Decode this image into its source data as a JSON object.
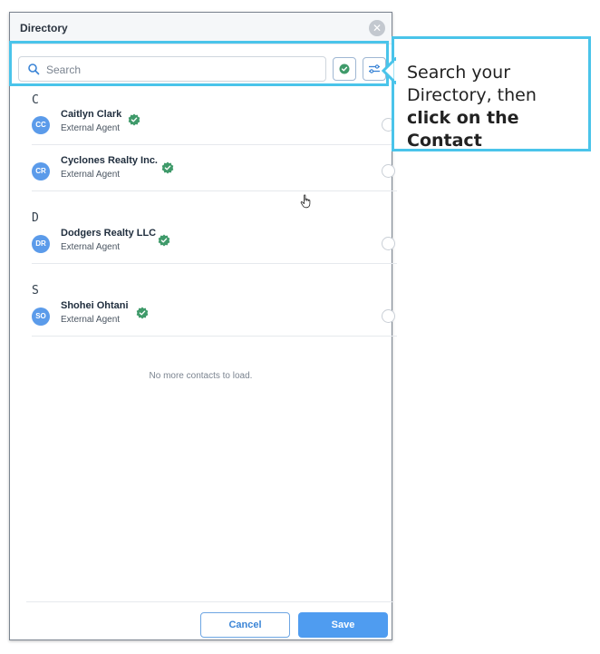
{
  "modal": {
    "title": "Directory",
    "close_icon": "close-icon"
  },
  "search": {
    "placeholder": "Search",
    "value": "",
    "icon": "search-icon",
    "verified_filter_icon": "verified-check-icon",
    "filter_icon": "sliders-icon"
  },
  "sections": [
    {
      "letter": "C",
      "contacts": [
        {
          "initials": "CC",
          "name": "Caitlyn Clark",
          "role": "External Agent",
          "verified": true
        },
        {
          "initials": "CR",
          "name": "Cyclones Realty Inc.",
          "role": "External Agent",
          "verified": true
        }
      ]
    },
    {
      "letter": "D",
      "contacts": [
        {
          "initials": "DR",
          "name": "Dodgers Realty LLC",
          "role": "External Agent",
          "verified": true
        }
      ]
    },
    {
      "letter": "S",
      "contacts": [
        {
          "initials": "SO",
          "name": "Shohei Ohtani",
          "role": "External Agent",
          "verified": true
        }
      ]
    }
  ],
  "status_text": "No more contacts to load.",
  "footer": {
    "cancel_label": "Cancel",
    "save_label": "Save"
  },
  "callout": {
    "text_plain": "Search your Directory, then ",
    "text_bold": "click on the Contact"
  },
  "colors": {
    "accent": "#4f9cf0",
    "highlight": "#4ac4ea",
    "avatar": "#5b9bea",
    "verified": "#3f9a6a"
  }
}
